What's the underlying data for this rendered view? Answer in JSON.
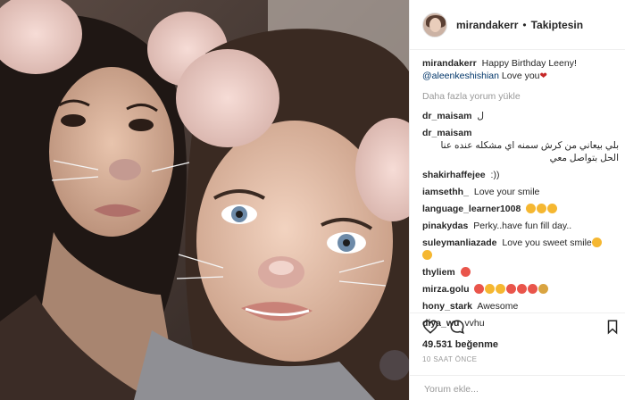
{
  "header": {
    "username": "mirandakerr",
    "separator": "•",
    "follow_label": "Takiptesin"
  },
  "caption": {
    "username": "mirandakerr",
    "text": "Happy Birthday Leeny!",
    "mention": "@aleenkeshishian",
    "text2": "Love you"
  },
  "load_more": "Daha fazla yorum yükle",
  "comments": [
    {
      "user": "dr_maisam",
      "text": "ل"
    },
    {
      "user": "dr_maisam",
      "text": "بلي بيعاني من كرش سمنه اي مشكله عنده عنا الحل بتواصل معي"
    },
    {
      "user": "shakirhaffejee",
      "text": ":))"
    },
    {
      "user": "iamsethh_",
      "text": "Love your smile"
    },
    {
      "user": "language_learner1008",
      "text": ""
    },
    {
      "user": "pinakydas",
      "text": "Perky..have fun fill day.."
    },
    {
      "user": "suleymanliazade",
      "text": "Love you sweet smile"
    },
    {
      "user": "thyliem",
      "text": ""
    },
    {
      "user": "mirza.golu",
      "text": ""
    },
    {
      "user": "hony_stark",
      "text": "Awesome"
    },
    {
      "user": "diya_wu",
      "text": "vvhu"
    }
  ],
  "icons": {
    "like": "heart-icon",
    "comment": "comment-icon",
    "save": "bookmark-icon"
  },
  "likes_text": "49.531 beğenme",
  "time_text": "10 SAAT ÖNCE",
  "add_comment_placeholder": "Yorum ekle...",
  "colors": {
    "emoji": "#f5b731",
    "heart": "#e53935",
    "mention": "#003569",
    "muted": "#999999"
  }
}
